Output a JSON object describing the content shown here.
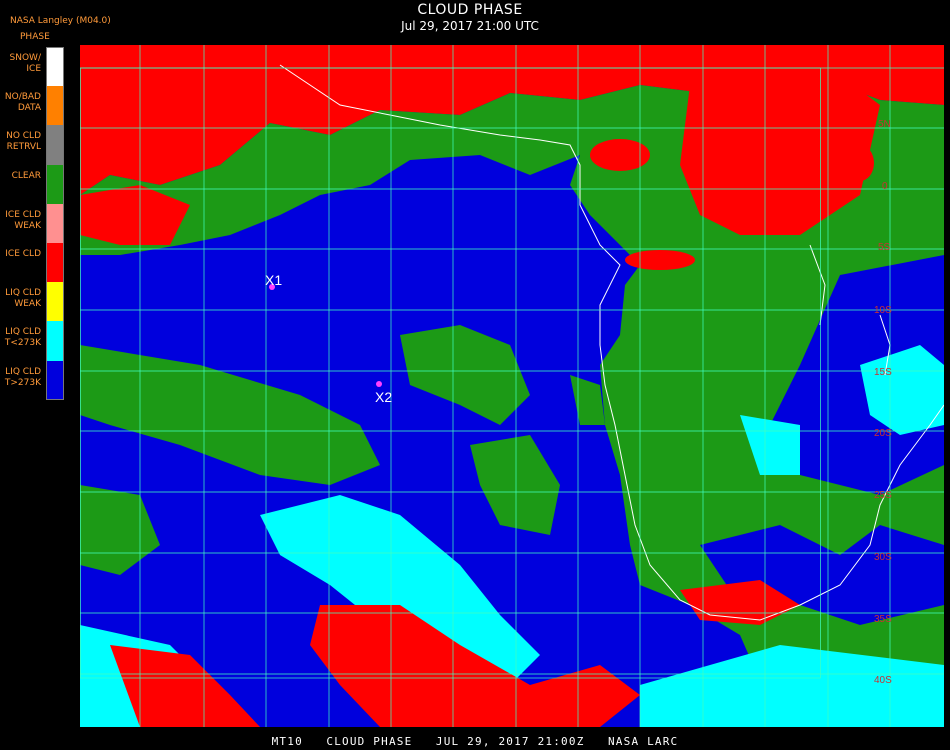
{
  "header": {
    "credit": "NASA Langley (M04.0)",
    "phase_label": "PHASE",
    "title": "CLOUD PHASE",
    "subtitle": "Jul 29, 2017 21:00 UTC"
  },
  "legend": [
    {
      "label": "SNOW/\nICE",
      "color": "#ffffff"
    },
    {
      "label": "NO/BAD\nDATA",
      "color": "#ff8000"
    },
    {
      "label": "NO CLD\nRETRVL",
      "color": "#808080"
    },
    {
      "label": "CLEAR",
      "color": "#1c9a16"
    },
    {
      "label": "ICE CLD\nWEAK",
      "color": "#ff9090"
    },
    {
      "label": "ICE CLD",
      "color": "#ff0000"
    },
    {
      "label": "LIQ CLD\nWEAK",
      "color": "#ffff00"
    },
    {
      "label": "LIQ CLD\nT<273K",
      "color": "#00ffff"
    },
    {
      "label": "LIQ CLD\nT>273K",
      "color": "#0000dd"
    }
  ],
  "markers": [
    {
      "label": "X1",
      "color": "#ff40ff"
    },
    {
      "label": "X2",
      "color": "#ff40ff"
    }
  ],
  "lat_labels": [
    "5N",
    "0",
    "5S",
    "10S",
    "15S",
    "20S",
    "25S",
    "30S",
    "35S",
    "40S"
  ],
  "colors": {
    "ice": "#ff0000",
    "clear": "#1c9a16",
    "liq_warm": "#0000dd",
    "liq_cold": "#00ffff",
    "grid": "#40ffc0",
    "lat_label": "#c83232"
  },
  "footer": "MT10   CLOUD PHASE   JUL 29, 2017 21:00Z   NASA LARC"
}
